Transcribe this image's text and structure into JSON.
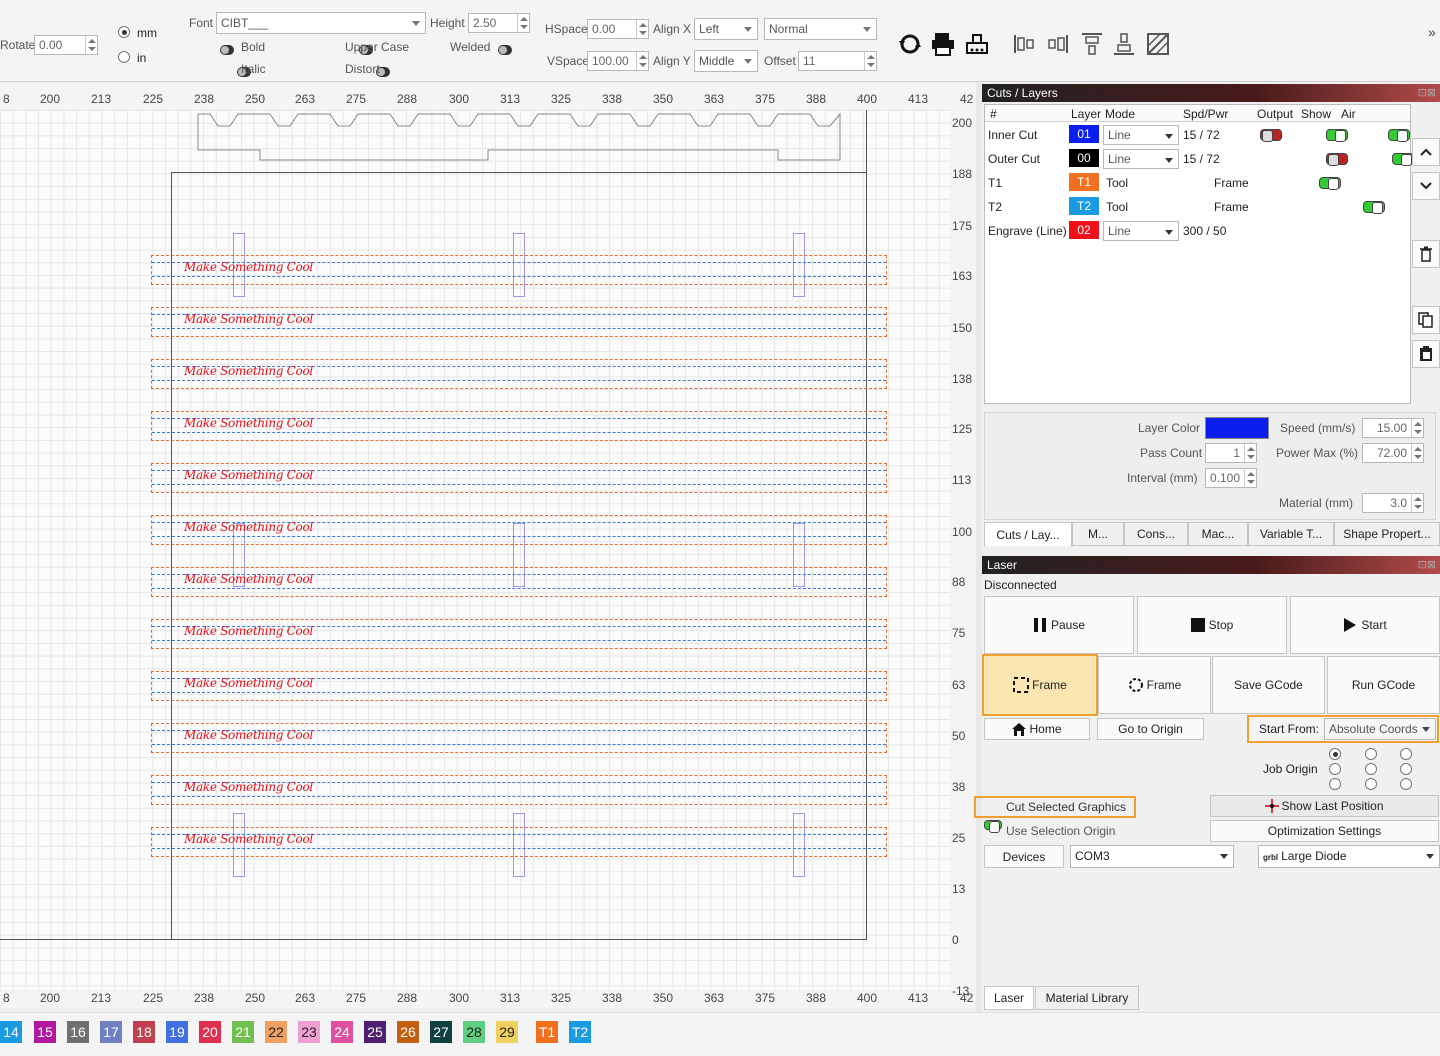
{
  "toolbar": {
    "rotate_label": "Rotate",
    "rotate_value": "0.00",
    "unit_mm": "mm",
    "unit_in": "in",
    "font_label": "Font",
    "font_value": "CIBT___",
    "height_label": "Height",
    "height_value": "2.50",
    "hspace_label": "HSpace",
    "hspace_value": "0.00",
    "vspace_label": "VSpace",
    "vspace_value": "100.00",
    "alignx_label": "Align X",
    "alignx_value": "Left",
    "aligny_label": "Align Y",
    "aligny_value": "Middle",
    "normal_value": "Normal",
    "offset_label": "Offset",
    "offset_value": "11",
    "bold": "Bold",
    "italic": "Italic",
    "upper_case": "Upper Case",
    "distort": "Distort",
    "welded": "Welded",
    "overflow": "»"
  },
  "ruler": {
    "top_ticks": [
      "8",
      "200",
      "213",
      "225",
      "238",
      "250",
      "263",
      "275",
      "288",
      "300",
      "313",
      "325",
      "338",
      "350",
      "363",
      "375",
      "388",
      "400",
      "413",
      "42"
    ],
    "side_ticks": [
      "200",
      "188",
      "175",
      "163",
      "150",
      "138",
      "125",
      "113",
      "100",
      "88",
      "75",
      "63",
      "50",
      "38",
      "25",
      "13",
      "0",
      "-13"
    ]
  },
  "canvas": {
    "label": "Make Something Cool",
    "rows": 12
  },
  "cuts": {
    "title": "Cuts / Layers",
    "headers": [
      "#",
      "Layer",
      "Mode",
      "Spd/Pwr",
      "Output",
      "Show",
      "Air"
    ],
    "rows": [
      {
        "name": "Inner Cut",
        "layer": "01",
        "color": "#0a1ef0",
        "mode": "Line",
        "spd": "15 / 72"
      },
      {
        "name": "Outer Cut",
        "layer": "00",
        "color": "#000000",
        "mode": "Line",
        "spd": "15 / 72"
      },
      {
        "name": "T1",
        "layer": "T1",
        "color": "#f07020",
        "mode": "Tool",
        "spd": "Frame"
      },
      {
        "name": "T2",
        "layer": "T2",
        "color": "#1a9ae0",
        "mode": "Tool",
        "spd": "Frame"
      },
      {
        "name": "Engrave (Line)",
        "layer": "02",
        "color": "#f0101a",
        "mode": "Line",
        "spd": "300 / 50"
      }
    ],
    "props": {
      "layer_color": "Layer Color",
      "pass_count": "Pass Count",
      "pass_count_value": "1",
      "interval": "Interval (mm)",
      "interval_value": "0.100",
      "speed": "Speed (mm/s)",
      "speed_value": "15.00",
      "power_max": "Power Max (%)",
      "power_max_value": "72.00",
      "material": "Material (mm)",
      "material_value": "3.0",
      "layer_color_hex": "#0a1ef0"
    },
    "tabs": [
      "Cuts / Lay...",
      "M...",
      "Cons...",
      "Mac...",
      "Variable T...",
      "Shape Propert..."
    ]
  },
  "laser": {
    "title": "Laser",
    "status": "Disconnected",
    "pause": "Pause",
    "stop": "Stop",
    "start": "Start",
    "frame1": "Frame",
    "frame2": "Frame",
    "save_gcode": "Save GCode",
    "run_gcode": "Run GCode",
    "home": "Home",
    "go_origin": "Go to Origin",
    "start_from_label": "Start From:",
    "start_from_value": "Absolute Coords",
    "job_origin": "Job Origin",
    "cut_selected": "Cut Selected Graphics",
    "use_selection": "Use Selection Origin",
    "show_last": "Show Last Position",
    "opt_settings": "Optimization Settings",
    "devices": "Devices",
    "port": "COM3",
    "device_prefix": "grbl",
    "device": "Large Diode",
    "bottom_tabs": [
      "Laser",
      "Material Library"
    ]
  },
  "palette": [
    {
      "label": "14",
      "color": "#1a9ae0"
    },
    {
      "label": "15",
      "color": "#b0189e"
    },
    {
      "label": "16",
      "color": "#707070"
    },
    {
      "label": "17",
      "color": "#7080c0"
    },
    {
      "label": "18",
      "color": "#c04050"
    },
    {
      "label": "19",
      "color": "#4070e0"
    },
    {
      "label": "20",
      "color": "#e03050"
    },
    {
      "label": "21",
      "color": "#70c050"
    },
    {
      "label": "22",
      "color": "#f0a060"
    },
    {
      "label": "23",
      "color": "#f0a0d0"
    },
    {
      "label": "24",
      "color": "#e050a0"
    },
    {
      "label": "25",
      "color": "#502070"
    },
    {
      "label": "26",
      "color": "#c06010"
    },
    {
      "label": "27",
      "color": "#104040"
    },
    {
      "label": "28",
      "color": "#60d080"
    },
    {
      "label": "29",
      "color": "#f0d060"
    },
    {
      "label": "T1",
      "color": "#f07020"
    },
    {
      "label": "T2",
      "color": "#1a9ae0"
    }
  ]
}
